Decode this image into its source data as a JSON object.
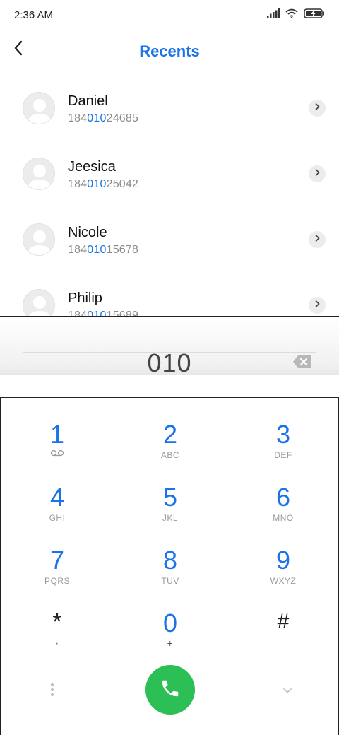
{
  "status_bar": {
    "time": "2:36 AM",
    "icons": [
      "signal-icon",
      "wifi-icon",
      "battery-charging-icon"
    ]
  },
  "header": {
    "title": "Recents",
    "back_icon": "back-arrow-icon"
  },
  "contacts": [
    {
      "name": "Daniel",
      "number_prefix": "184",
      "number_match": "010",
      "number_suffix": "24685"
    },
    {
      "name": "Jeesica",
      "number_prefix": "184",
      "number_match": "010",
      "number_suffix": "25042"
    },
    {
      "name": "Nicole",
      "number_prefix": "184",
      "number_match": "010",
      "number_suffix": "15678"
    },
    {
      "name": "Philip",
      "number_prefix": "184",
      "number_match": "010",
      "number_suffix": "15689"
    }
  ],
  "dialer": {
    "input_value": "010",
    "backspace_icon": "backspace-icon"
  },
  "keypad": {
    "keys": [
      {
        "digit": "1",
        "letters": ""
      },
      {
        "digit": "2",
        "letters": "ABC"
      },
      {
        "digit": "3",
        "letters": "DEF"
      },
      {
        "digit": "4",
        "letters": "GHI"
      },
      {
        "digit": "5",
        "letters": "JKL"
      },
      {
        "digit": "6",
        "letters": "MNO"
      },
      {
        "digit": "7",
        "letters": "PQRS"
      },
      {
        "digit": "8",
        "letters": "TUV"
      },
      {
        "digit": "9",
        "letters": "WXYZ"
      },
      {
        "digit": "*",
        "letters": ","
      },
      {
        "digit": "0",
        "letters": "+"
      },
      {
        "digit": "#",
        "letters": ""
      }
    ],
    "key1_sub_icon": "voicemail-icon"
  },
  "actions": {
    "more_icon": "more-vertical-icon",
    "call_icon": "phone-icon",
    "collapse_icon": "chevron-down-icon"
  },
  "colors": {
    "accent": "#1a73e8",
    "call_green": "#2bbf55"
  }
}
